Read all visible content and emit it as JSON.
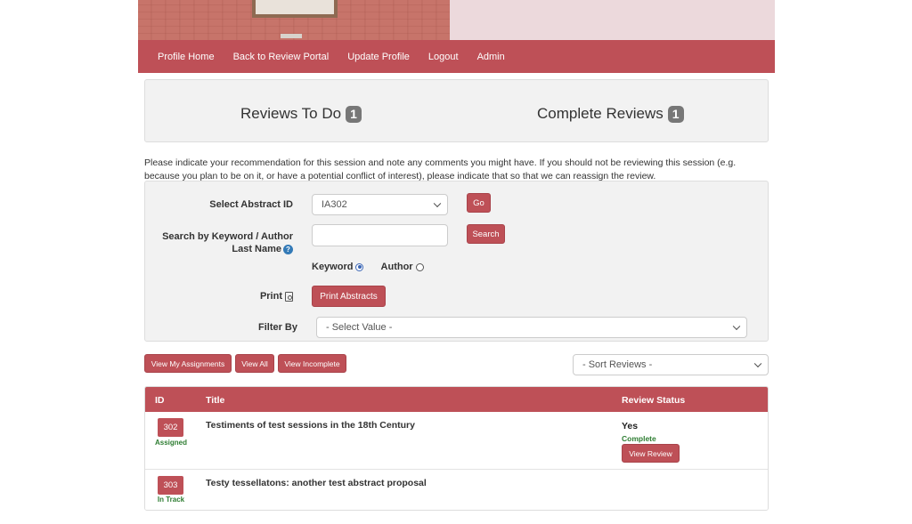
{
  "nav": {
    "items": [
      "Profile Home",
      "Back to Review Portal",
      "Update Profile",
      "Logout",
      "Admin"
    ]
  },
  "stats": {
    "todo_label": "Reviews To Do",
    "todo_count": "1",
    "complete_label": "Complete Reviews",
    "complete_count": "1"
  },
  "intro": "Please indicate your recommendation for this session and note any comments you might have. If you should not be reviewing this session (e.g. because you plan to be on it, or have a potential conflict of interest), please indicate that so that we can reassign the review.",
  "form": {
    "abstract_label": "Select Abstract ID",
    "abstract_value": "IA302",
    "go_label": "Go",
    "search_label_line1": "Search by Keyword / Author",
    "search_label_line2": "Last Name",
    "search_value": "",
    "search_button": "Search",
    "radio_keyword": "Keyword",
    "radio_author": "Author",
    "print_label": "Print",
    "print_button": "Print Abstracts",
    "filter_label": "Filter By",
    "filter_value": "- Select Value -"
  },
  "toolbar": {
    "my_assignments": "View My Assignments",
    "view_all": "View All",
    "view_incomplete": "View Incomplete",
    "sort_value": "- Sort Reviews -"
  },
  "table": {
    "headers": {
      "id": "ID",
      "title": "Title",
      "status": "Review Status"
    },
    "rows": [
      {
        "id": "302",
        "state": "Assigned",
        "title": "Testiments of test sessions in the 18th Century",
        "status": "Yes",
        "status_sub": "Complete",
        "action": "View Review"
      },
      {
        "id": "303",
        "state": "In Track",
        "title": "Testy tessellatons: another test abstract proposal",
        "status": "",
        "status_sub": "",
        "action": ""
      }
    ]
  },
  "colors": {
    "accent": "#be5057",
    "panel": "#f2f2f2",
    "success": "#2e7d32",
    "badge": "#777777"
  }
}
